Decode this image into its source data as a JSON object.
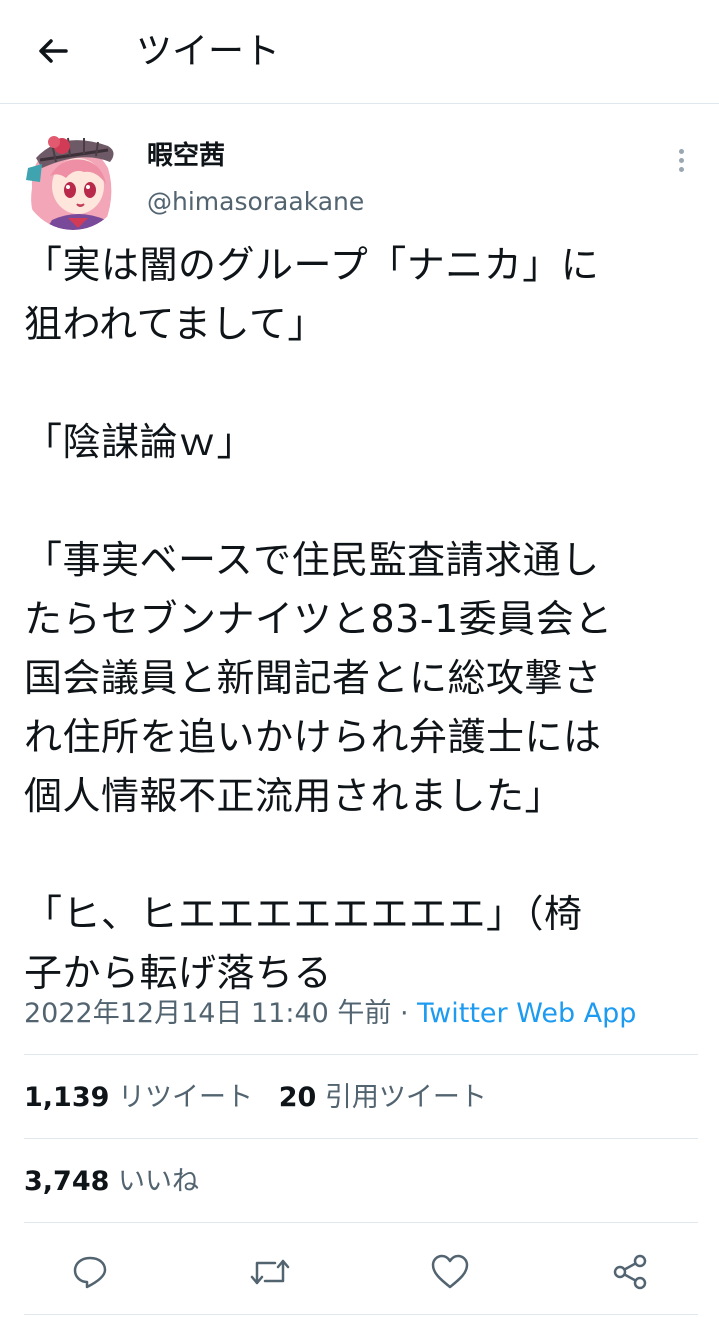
{
  "header": {
    "title": "ツイート",
    "back_icon": "arrow-left-icon"
  },
  "author": {
    "display_name": "暇空茜",
    "handle": "@himasoraakane",
    "avatar": "anime-girl-avatar"
  },
  "tweet": {
    "text": "「実は闇のグループ「ナニカ」に\n狙われてまして」\n\n「陰謀論ｗ」\n\n「事実ベースで住民監査請求通し\nたらセブンナイツと83-1委員会と\n国会議員と新聞記者とに総攻撃さ\nれ住所を追いかけられ弁護士には\n個人情報不正流用されました」\n\n「ヒ、ヒエエエエエエエエ」（椅\n子から転げ落ちる",
    "timestamp": "2022年12月14日 11:40 午前",
    "separator": " · ",
    "source": "Twitter Web App"
  },
  "stats": {
    "retweets_count": "1,139",
    "retweets_label": "リツイート",
    "quotes_count": "20",
    "quotes_label": "引用ツイート",
    "likes_count": "3,748",
    "likes_label": "いいね"
  },
  "actions": [
    "reply-icon",
    "retweet-icon",
    "like-icon",
    "share-icon"
  ],
  "colors": {
    "text": "#0f1419",
    "secondary": "#536471",
    "link": "#1d9bf0",
    "divider": "#e1e8ed"
  }
}
